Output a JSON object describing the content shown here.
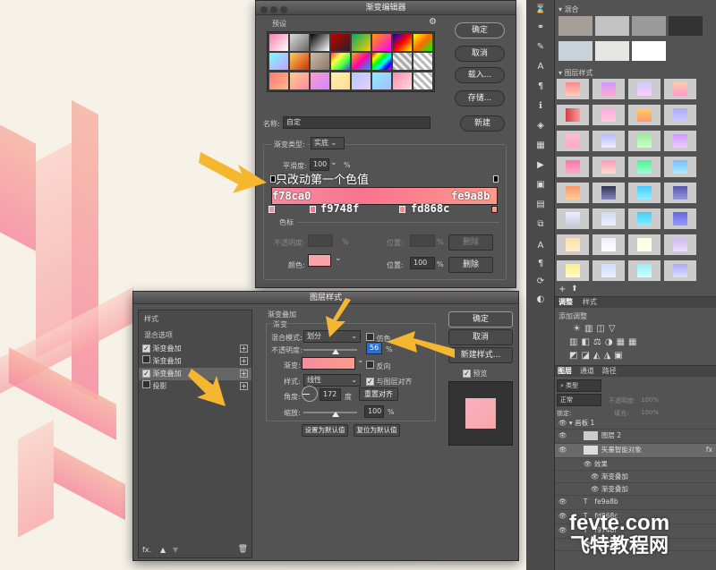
{
  "gradient_editor": {
    "title": "渐变编辑器",
    "presets_label": "预设",
    "ok": "确定",
    "cancel": "取消",
    "load": "载入...",
    "save": "存储...",
    "name_label": "名称:",
    "name_value": "自定",
    "new_button": "新建",
    "type_label": "渐变类型:",
    "type_value": "实底",
    "smoothness_label": "平滑度:",
    "smoothness_value": "100",
    "smoothness_unit": "%",
    "stops_section": "色标",
    "opacity_label": "不透明度:",
    "opacity_unit": "%",
    "location_label": "位置:",
    "location_unit": "%",
    "location_value": "100",
    "delete_label": "删除",
    "color_label": "颜色:",
    "stop_color": "#f9a4a6"
  },
  "annotations": {
    "note": "只改动第一个色值",
    "color_left": "f78ca0",
    "color_right": "fe9a8b",
    "color_mid1": "f9748f",
    "color_mid2": "fd868c"
  },
  "layer_style": {
    "title": "图层样式",
    "sidebar_header": "样式",
    "blend_options": "混合选项",
    "items": [
      {
        "label": "渐变叠加",
        "checked": true
      },
      {
        "label": "渐变叠加",
        "checked": false
      },
      {
        "label": "渐变叠加",
        "checked": true
      },
      {
        "label": "投影",
        "checked": false
      }
    ],
    "fx_label": "fx.",
    "section_title": "渐变叠加",
    "sub_title": "渐变",
    "blend_mode_label": "混合模式:",
    "blend_mode_value": "划分",
    "dither_label": "仿色",
    "opacity_label": "不透明度:",
    "opacity_value": "56",
    "opacity_unit": "%",
    "gradient_label": "渐变:",
    "reverse_label": "反向",
    "style_label": "样式:",
    "style_value": "线性",
    "align_label": "与图层对齐",
    "angle_label": "角度:",
    "angle_value": "172",
    "angle_unit": "度",
    "reset_align": "重置对齐",
    "scale_label": "缩放:",
    "scale_value": "100",
    "scale_unit": "%",
    "set_default": "设置为默认值",
    "reset_default": "复位为默认值",
    "ok": "确定",
    "cancel": "取消",
    "new_style": "新建样式...",
    "preview_label": "预览"
  },
  "right_panel": {
    "swatches_header": "混合",
    "styles_header": "图层样式",
    "tabs_styles": [
      "调整",
      "样式"
    ],
    "add_adjust": "添加调整",
    "layers_tabs": [
      "图层",
      "通道",
      "路径"
    ],
    "kind_label": "类型",
    "normal": "正常",
    "opacity": "不透明度:",
    "opacity_value": "100%",
    "fill": "填充:",
    "fill_value": "100%",
    "lock": "锁定:",
    "layers": [
      {
        "name": "画板 1",
        "indent": 0
      },
      {
        "name": "图层 2",
        "indent": 1
      },
      {
        "name": "矢量智能对象",
        "indent": 1
      },
      {
        "name": "效果",
        "indent": 2
      },
      {
        "name": "渐变叠加",
        "indent": 3
      },
      {
        "name": "渐变叠加",
        "indent": 3
      },
      {
        "name": "fe9a8b",
        "indent": 1
      },
      {
        "name": "fd868c",
        "indent": 1
      },
      {
        "name": "f9748f",
        "indent": 1
      },
      {
        "name": "效果",
        "indent": 2
      }
    ]
  },
  "watermark": {
    "line1": "fevte.com",
    "line2": "飞特教程网"
  }
}
